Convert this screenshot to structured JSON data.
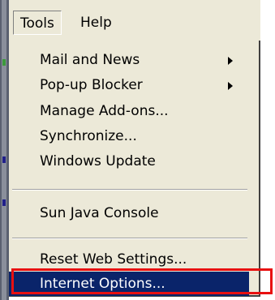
{
  "menubar": {
    "items": [
      {
        "label": "Tools",
        "state": "open"
      },
      {
        "label": "Help"
      }
    ]
  },
  "menu": {
    "items": [
      {
        "label": "Mail and News",
        "has_submenu": true
      },
      {
        "label": "Pop-up Blocker",
        "has_submenu": true
      },
      {
        "label": "Manage Add-ons..."
      },
      {
        "label": "Synchronize..."
      },
      {
        "label": "Windows Update"
      },
      {
        "label": "Sun Java Console"
      },
      {
        "label": "Reset Web Settings..."
      },
      {
        "label": "Internet Options...",
        "highlighted": true
      }
    ]
  },
  "colors": {
    "menu_background": "#ece9d8",
    "highlight": "#0a246a",
    "highlight_text": "#ffffff",
    "annotation": "#e81010"
  },
  "icons": {
    "submenu_indicator": "submenu-arrow-icon"
  }
}
